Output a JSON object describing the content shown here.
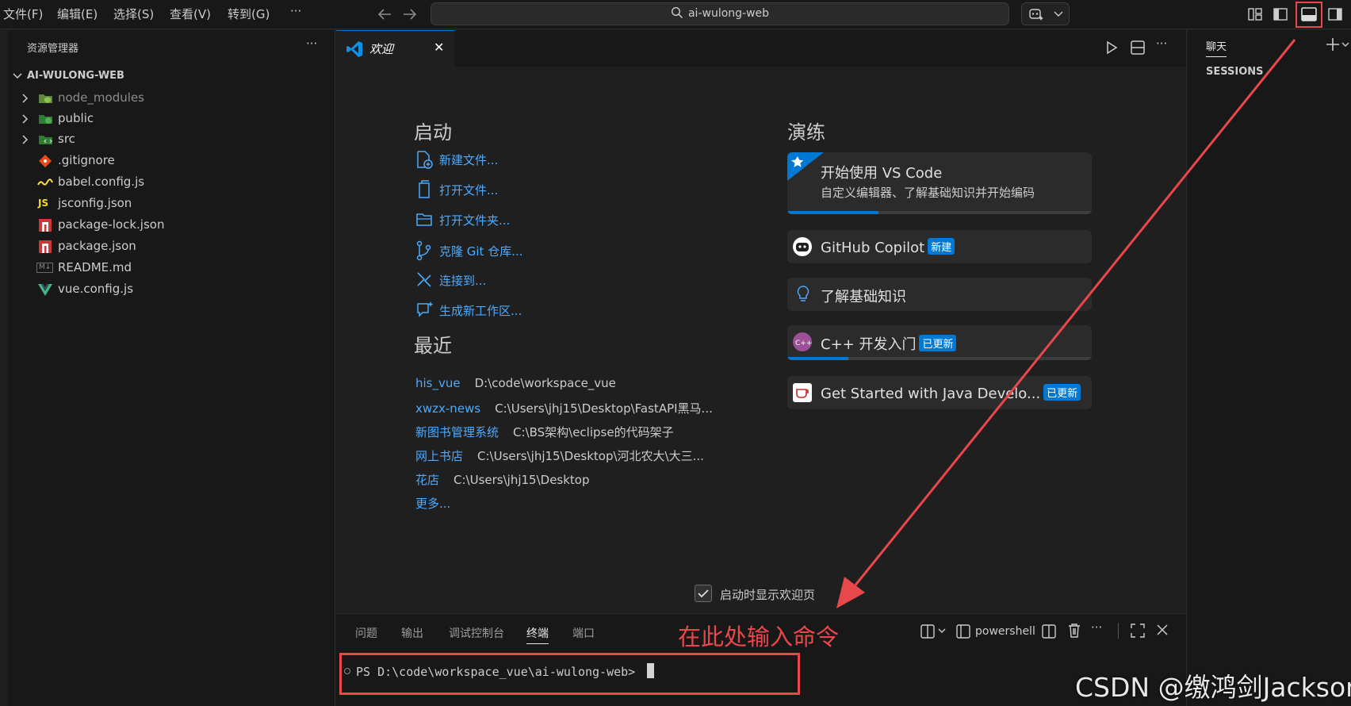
{
  "menu": [
    "文件(F)",
    "编辑(E)",
    "选择(S)",
    "查看(V)",
    "转到(G)",
    "···"
  ],
  "search": {
    "text": "ai-wulong-web"
  },
  "sidebar": {
    "title": "资源管理器",
    "more": "···",
    "project": "AI-WULONG-WEB",
    "items": [
      {
        "label": "node_modules",
        "icon": "node-modules-folder-icon"
      },
      {
        "label": "public",
        "icon": "public-folder-icon"
      },
      {
        "label": "src",
        "icon": "src-folder-icon"
      },
      {
        "label": ".gitignore",
        "icon": "git-icon"
      },
      {
        "label": "babel.config.js",
        "icon": "babel-icon"
      },
      {
        "label": "jsconfig.json",
        "icon": "js-icon"
      },
      {
        "label": "package-lock.json",
        "icon": "npm-icon"
      },
      {
        "label": "package.json",
        "icon": "npm-icon"
      },
      {
        "label": "README.md",
        "icon": "markdown-icon"
      },
      {
        "label": "vue.config.js",
        "icon": "vue-icon"
      }
    ],
    "js_glyph": "JS",
    "md_glyph": "M↓"
  },
  "tab": {
    "label": "欢迎",
    "close": "✕"
  },
  "welcome": {
    "start_title": "启动",
    "start_items": [
      "新建文件...",
      "打开文件...",
      "打开文件夹...",
      "克隆 Git 仓库...",
      "连接到...",
      "生成新工作区..."
    ],
    "recent_title": "最近",
    "recent": [
      {
        "name": "his_vue",
        "path": "D:\\code\\workspace_vue"
      },
      {
        "name": "xwzx-news",
        "path": "C:\\Users\\jhj15\\Desktop\\FastAPI黑马..."
      },
      {
        "name": "新图书管理系统",
        "path": "C:\\BS架构\\eclipse的代码架子"
      },
      {
        "name": "网上书店",
        "path": "C:\\Users\\jhj15\\Desktop\\河北农大\\大三..."
      },
      {
        "name": "花店",
        "path": "C:\\Users\\jhj15\\Desktop"
      }
    ],
    "more": "更多...",
    "walk_title": "演练",
    "walkthroughs": [
      {
        "title": "开始使用 VS Code",
        "desc": "自定义编辑器、了解基础知识并开始编码",
        "progress": 0.3
      },
      {
        "title": "GitHub Copilot",
        "badge": "新建"
      },
      {
        "title": "了解基础知识"
      },
      {
        "title": "C++ 开发入门",
        "badge": "已更新",
        "progress": 0.2
      },
      {
        "title": "Get Started with Java Develo...",
        "badge": "已更新"
      }
    ],
    "show_on_startup": "启动时显示欢迎页",
    "show_on_startup_checked": true
  },
  "panel": {
    "tabs": [
      "问题",
      "输出",
      "调试控制台",
      "终端",
      "端口"
    ],
    "active_tab": "终端",
    "shell": "powershell",
    "prompt": "PS D:\\code\\workspace_vue\\ai-wulong-web> ",
    "annotation": "在此处输入命令"
  },
  "chat": {
    "title": "聊天",
    "sessions": "SESSIONS"
  },
  "watermark": "CSDN @缴鸿剑Jackson",
  "colors": {
    "annotation_red": "#e8474c",
    "link": "#4daafc",
    "badge": "#0078d4"
  }
}
